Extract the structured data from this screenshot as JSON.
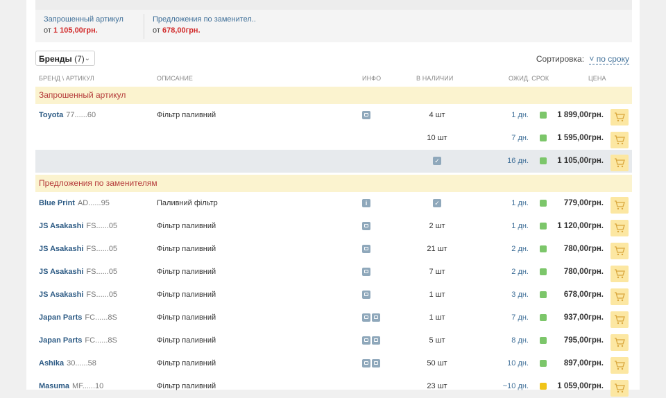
{
  "summary": {
    "requested_label": "Запрошенный артикул",
    "requested_price_prefix": "от",
    "requested_price": "1 105,00грн.",
    "substitutes_label": "Предложения по заменител..",
    "substitutes_price_prefix": "от",
    "substitutes_price": "678,00грн."
  },
  "filters": {
    "brands_label": "Бренды",
    "brands_count": "(7)",
    "sort_label": "Сортировка:",
    "sort_value": "по сроку"
  },
  "columns": {
    "brand": "Бренд \\",
    "article": "Артикул",
    "description": "Описание",
    "info": "Инфо",
    "stock": "В наличии",
    "term": "Ожид. срок",
    "price": "Цена"
  },
  "sections": {
    "requested": "Запрошенный артикул",
    "substitutes": "Предложения по заменителям"
  },
  "colors": {
    "dot_green": "#7cc66a",
    "dot_yellow": "#f0c419"
  },
  "requested_rows": [
    {
      "brand": "Toyota",
      "article": "77......60",
      "description": "Фільтр паливний",
      "info": "car",
      "stock": "4 шт",
      "term": "1 дн.",
      "status": "green",
      "price": "1 899,00",
      "currency": "грн."
    },
    {
      "brand": "",
      "article": "",
      "description": "",
      "info": "",
      "stock": "10 шт",
      "term": "7 дн.",
      "status": "green",
      "price": "1 595,00",
      "currency": "грн."
    },
    {
      "brand": "",
      "article": "",
      "description": "",
      "info": "",
      "stock": "check",
      "term": "16 дн.",
      "status": "green",
      "price": "1 105,00",
      "currency": "грн."
    }
  ],
  "substitute_rows": [
    {
      "brand": "Blue Print",
      "article": "AD......95",
      "description": "Паливний фільтр",
      "info": "i",
      "stock": "check",
      "term": "1 дн.",
      "status": "green",
      "price": "779,00",
      "currency": "грн."
    },
    {
      "brand": "JS Asakashi",
      "article": "FS......05",
      "description": "Фільтр паливний",
      "info": "car",
      "stock": "2 шт",
      "term": "1 дн.",
      "status": "green",
      "price": "1 120,00",
      "currency": "грн."
    },
    {
      "brand": "JS Asakashi",
      "article": "FS......05",
      "description": "Фільтр паливний",
      "info": "car",
      "stock": "21 шт",
      "term": "2 дн.",
      "status": "green",
      "price": "780,00",
      "currency": "грн."
    },
    {
      "brand": "JS Asakashi",
      "article": "FS......05",
      "description": "Фільтр паливний",
      "info": "car",
      "stock": "7 шт",
      "term": "2 дн.",
      "status": "green",
      "price": "780,00",
      "currency": "грн."
    },
    {
      "brand": "JS Asakashi",
      "article": "FS......05",
      "description": "Фільтр паливний",
      "info": "car",
      "stock": "1 шт",
      "term": "3 дн.",
      "status": "green",
      "price": "678,00",
      "currency": "грн."
    },
    {
      "brand": "Japan Parts",
      "article": "FC......8S",
      "description": "Фільтр паливний",
      "info": "car2",
      "stock": "1 шт",
      "term": "7 дн.",
      "status": "green",
      "price": "937,00",
      "currency": "грн."
    },
    {
      "brand": "Japan Parts",
      "article": "FC......8S",
      "description": "Фільтр паливний",
      "info": "car2",
      "stock": "5 шт",
      "term": "8 дн.",
      "status": "green",
      "price": "795,00",
      "currency": "грн."
    },
    {
      "brand": "Ashika",
      "article": "30......58",
      "description": "Фільтр паливний",
      "info": "car2",
      "stock": "50 шт",
      "term": "10 дн.",
      "status": "green",
      "price": "897,00",
      "currency": "грн."
    },
    {
      "brand": "Masuma",
      "article": "MF......10",
      "description": "Фільтр паливний",
      "info": "",
      "stock": "23 шт",
      "term": "~10 дн.",
      "status": "yellow",
      "price": "1 059,00",
      "currency": "грн."
    }
  ]
}
